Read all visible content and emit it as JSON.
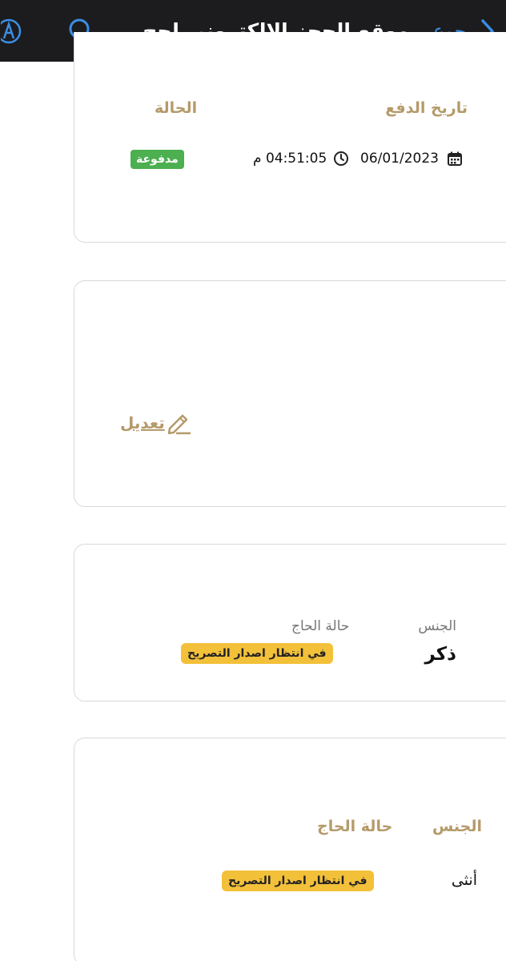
{
  "navbar": {
    "title": "موقع الحجز الإلكتروني لحج...",
    "back_label": "رجوع"
  },
  "payment_card": {
    "date_header": "تاريخ الدفع",
    "status_header": "الحالة",
    "date": "06/01/2023",
    "time": "04:51:05 م",
    "status": "مدفوعة"
  },
  "edit_card": {
    "edit_label": "تعديل"
  },
  "pilgrim_1": {
    "gender_label": "الجنس",
    "gender_value": "ذكر",
    "status_label": "حالة الحاج",
    "status_value": "في انتظار اصدار التصريح"
  },
  "pilgrim_2": {
    "gender_label": "الجنس",
    "gender_value": "أنثى",
    "status_label": "حالة الحاج",
    "status_value": "في انتظار اصدار التصريح"
  },
  "colors": {
    "navbar_bg": "#1c1c1e",
    "accent_blue": "#3a8ee6",
    "gold": "#b59a6a",
    "paid_green": "#4caf50",
    "pending_yellow": "#f3c03a"
  }
}
